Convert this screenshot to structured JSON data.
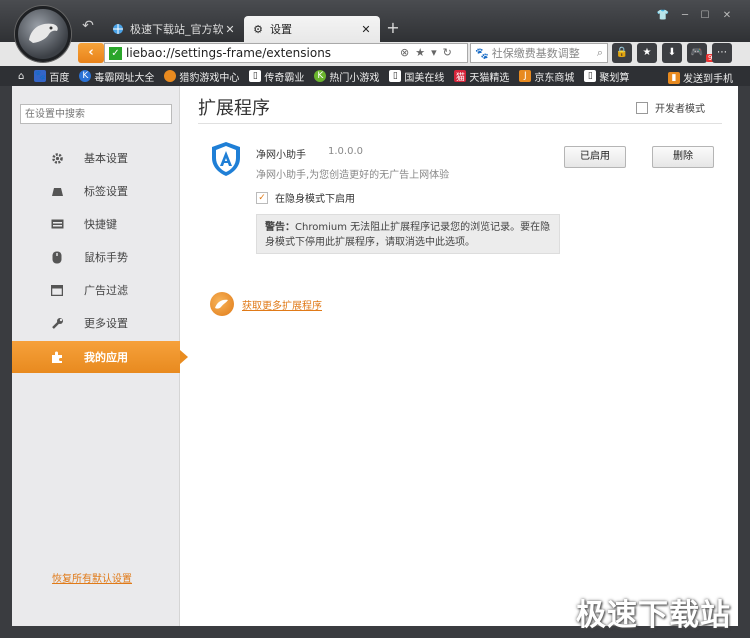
{
  "browser": {
    "tabs": [
      {
        "label": "极速下载站_官方软…",
        "active": false
      },
      {
        "label": "设置",
        "active": true
      }
    ],
    "address": "liebao://settings-frame/extensions",
    "search_placeholder": "社保缴费基数调整",
    "bookmarks": [
      "百度",
      "毒霸网址大全",
      "猎豹游戏中心",
      "传奇霸业",
      "热门小游戏",
      "国美在线",
      "天猫精选",
      "京东商城",
      "聚划算"
    ],
    "bookmark_right": "发送到手机",
    "badge": "9+"
  },
  "sidebar": {
    "search_placeholder": "在设置中搜索",
    "items": [
      {
        "label": "基本设置",
        "icon": "gear-icon"
      },
      {
        "label": "标签设置",
        "icon": "tab-icon"
      },
      {
        "label": "快捷键",
        "icon": "keyboard-icon"
      },
      {
        "label": "鼠标手势",
        "icon": "mouse-icon"
      },
      {
        "label": "广告过滤",
        "icon": "filter-icon"
      },
      {
        "label": "更多设置",
        "icon": "wrench-icon"
      },
      {
        "label": "我的应用",
        "icon": "puzzle-icon",
        "active": true
      }
    ],
    "reset_label": "恢复所有默认设置"
  },
  "main": {
    "title": "扩展程序",
    "dev_mode_label": "开发者模式",
    "extension": {
      "name": "净网小助手",
      "version": "1.0.0.0",
      "description": "净网小助手,为您创造更好的无广告上网体验",
      "enabled_label": "已启用",
      "delete_label": "删除",
      "incognito_label": "在隐身模式下启用",
      "warning_title": "警告：",
      "warning_text": "Chromium 无法阻止扩展程序记录您的浏览记录。要在隐身模式下停用此扩展程序，请取消选中此选项。"
    },
    "more_extensions_label": "获取更多扩展程序"
  },
  "watermark": "极速下载站",
  "colors": {
    "accent": "#e88a1f",
    "link": "#e07a18",
    "secure": "#2aa52a"
  }
}
